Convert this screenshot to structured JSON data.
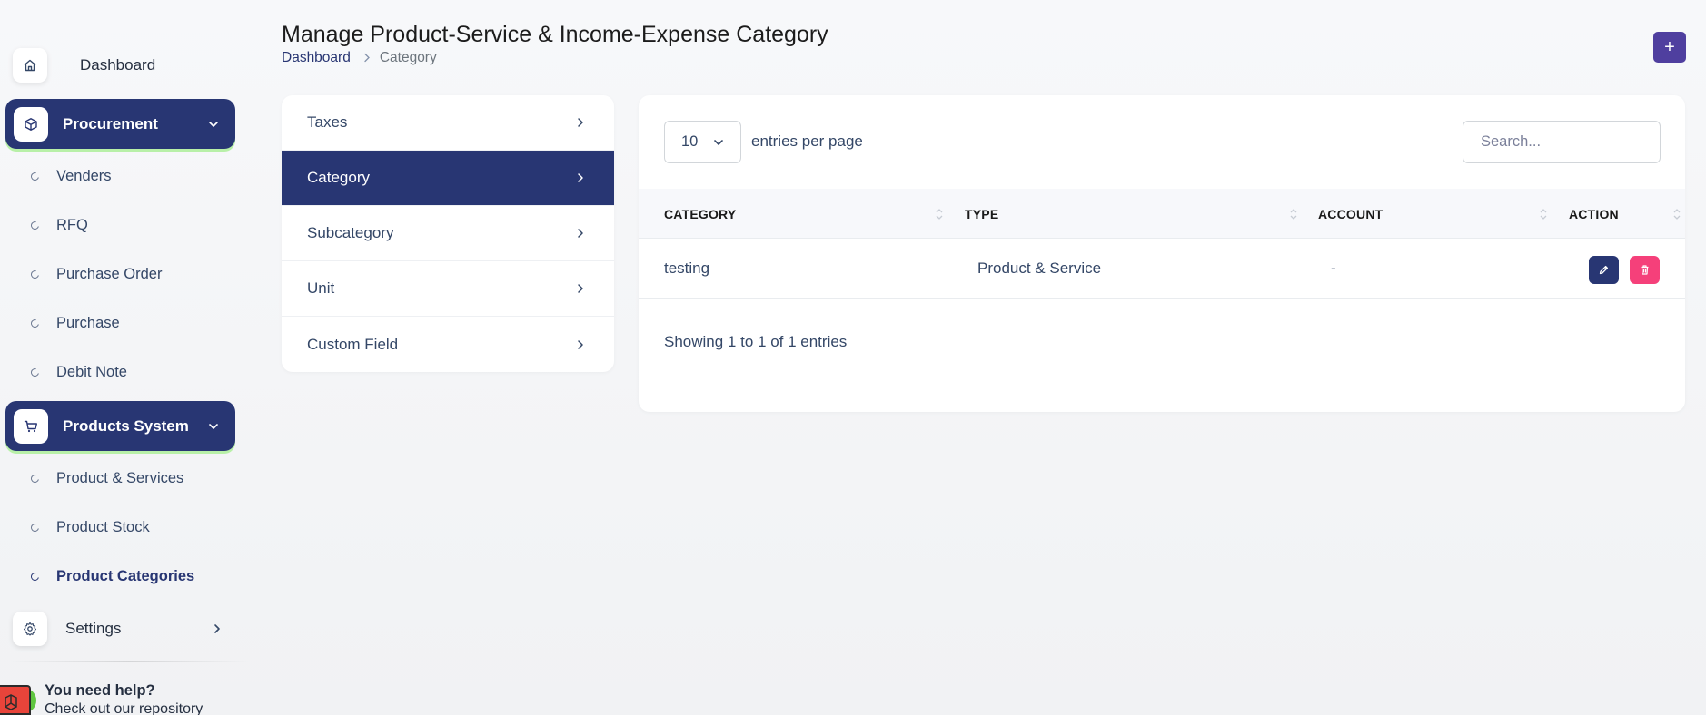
{
  "sidebar": {
    "dashboard": {
      "label": "Dashboard",
      "icon": "home-icon"
    },
    "procurement": {
      "label": "Procurement",
      "icon": "box-icon",
      "items": [
        {
          "label": "Venders"
        },
        {
          "label": "RFQ"
        },
        {
          "label": "Purchase Order"
        },
        {
          "label": "Purchase"
        },
        {
          "label": "Debit Note"
        }
      ]
    },
    "products_system": {
      "label": "Products System",
      "icon": "cart-icon",
      "items": [
        {
          "label": "Product & Services"
        },
        {
          "label": "Product Stock"
        },
        {
          "label": "Product Categories",
          "active": true
        }
      ]
    },
    "settings": {
      "label": "Settings",
      "icon": "gear-icon"
    },
    "help": {
      "title": "You need help?",
      "subtitle": "Check out our repository"
    }
  },
  "header": {
    "title": "Manage Product-Service & Income-Expense Category",
    "breadcrumb": {
      "home": "Dashboard",
      "current": "Category"
    },
    "add_button": "+"
  },
  "category_nav": {
    "items": [
      {
        "label": "Taxes"
      },
      {
        "label": "Category",
        "active": true
      },
      {
        "label": "Subcategory"
      },
      {
        "label": "Unit"
      },
      {
        "label": "Custom Field"
      }
    ]
  },
  "table": {
    "per_page_value": "10",
    "per_page_label": "entries per page",
    "search_placeholder": "Search...",
    "columns": [
      "CATEGORY",
      "TYPE",
      "ACCOUNT",
      "ACTION"
    ],
    "rows": [
      {
        "category": "testing",
        "type": "Product & Service",
        "account": "-"
      }
    ],
    "info": "Showing 1 to 1 of 1 entries"
  },
  "colors": {
    "primary": "#283673",
    "danger": "#f5407a",
    "add_button": "#4f3f9f",
    "active_glow": "#b8f0a8"
  }
}
